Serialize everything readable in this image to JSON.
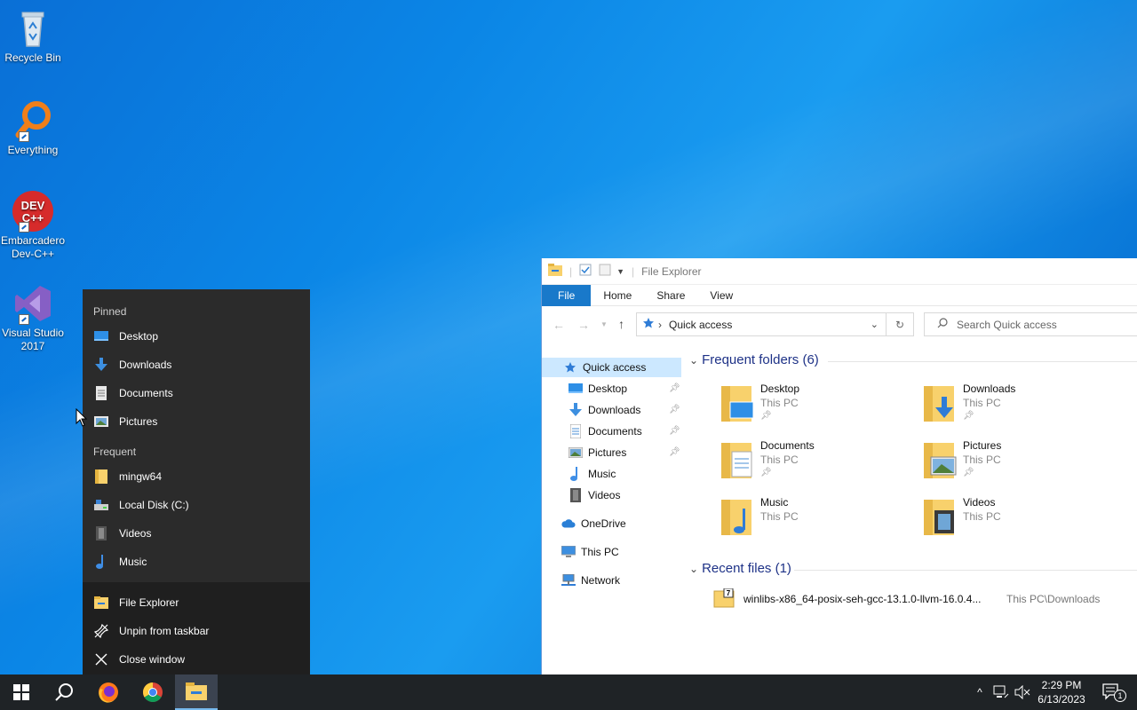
{
  "desktop": {
    "icons": [
      {
        "label": "Recycle Bin",
        "icon": "recycle-bin-icon"
      },
      {
        "label": "Everything",
        "icon": "everything-search-icon"
      },
      {
        "label": "Embarcadero Dev-C++",
        "icon": "devcpp-icon",
        "badge": "DEV C++"
      },
      {
        "label": "Visual Studio 2017",
        "icon": "visual-studio-icon"
      }
    ]
  },
  "jumplist": {
    "pinned_header": "Pinned",
    "pinned": [
      {
        "label": "Desktop",
        "icon": "desktop-icon"
      },
      {
        "label": "Downloads",
        "icon": "download-arrow-icon"
      },
      {
        "label": "Documents",
        "icon": "document-icon"
      },
      {
        "label": "Pictures",
        "icon": "pictures-icon"
      }
    ],
    "frequent_header": "Frequent",
    "frequent": [
      {
        "label": "mingw64",
        "icon": "folder-icon"
      },
      {
        "label": "Local Disk (C:)",
        "icon": "drive-icon"
      },
      {
        "label": "Videos",
        "icon": "film-icon"
      },
      {
        "label": "Music",
        "icon": "music-note-icon"
      }
    ],
    "actions": [
      {
        "label": "File Explorer",
        "icon": "file-explorer-icon"
      },
      {
        "label": "Unpin from taskbar",
        "icon": "unpin-icon"
      },
      {
        "label": "Close window",
        "icon": "close-icon"
      }
    ]
  },
  "explorer": {
    "title": "File Explorer",
    "ribbon_tabs": [
      "File",
      "Home",
      "Share",
      "View"
    ],
    "address": "Quick access",
    "search_placeholder": "Search Quick access",
    "nav": {
      "quick_access": "Quick access",
      "pinned": [
        "Desktop",
        "Downloads",
        "Documents",
        "Pictures"
      ],
      "others": [
        "Music",
        "Videos"
      ],
      "onedrive": "OneDrive",
      "this_pc": "This PC",
      "network": "Network"
    },
    "frequent_title": "Frequent folders (6)",
    "frequent": [
      {
        "name": "Desktop",
        "location": "This PC",
        "pinned": true
      },
      {
        "name": "Downloads",
        "location": "This PC",
        "pinned": true
      },
      {
        "name": "Documents",
        "location": "This PC",
        "pinned": true
      },
      {
        "name": "Pictures",
        "location": "This PC",
        "pinned": true
      },
      {
        "name": "Music",
        "location": "This PC",
        "pinned": false
      },
      {
        "name": "Videos",
        "location": "This PC",
        "pinned": false
      }
    ],
    "recent_title": "Recent files (1)",
    "recent": [
      {
        "name": "winlibs-x86_64-posix-seh-gcc-13.1.0-llvm-16.0.4...",
        "path": "This PC\\Downloads"
      }
    ]
  },
  "taskbar": {
    "apps": [
      "start-button",
      "search-button",
      "firefox",
      "chrome",
      "file-explorer"
    ],
    "time": "2:29 PM",
    "date": "6/13/2023",
    "notification_count": "1"
  },
  "colors": {
    "accent": "#1979ca",
    "jumplist_bg": "#2b2b2b",
    "taskbar_bg": "#1f2326",
    "folder_yellow": "#f8d16c"
  }
}
